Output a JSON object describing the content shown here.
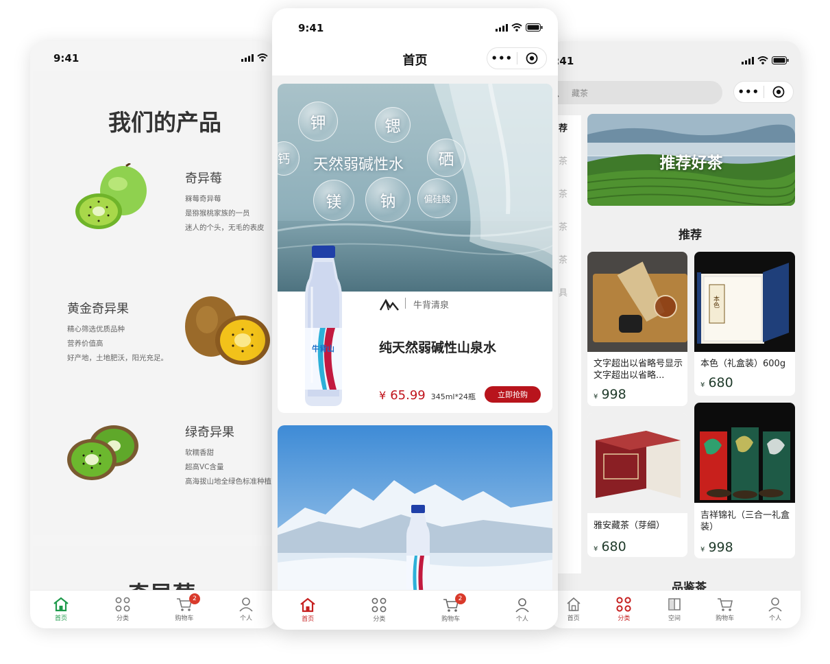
{
  "status": {
    "time": "9:41"
  },
  "left": {
    "section_title": "我们的产品",
    "products": [
      {
        "name": "奇异莓",
        "lines": [
          "槑莓奇异莓",
          "是猕猴桃家族的一员",
          "迷人的个头，无毛的表皮"
        ]
      },
      {
        "name": "黄金奇异果",
        "lines": [
          "精心筛选优质品种",
          "营养价值高",
          "好产地，土地肥沃，阳光充足。"
        ]
      },
      {
        "name": "绿奇异果",
        "lines": [
          "软糯香甜",
          "超高VC含量",
          "高海拔山地全绿色标准种植"
        ]
      }
    ],
    "next_title": "奇异莓",
    "tabs": [
      {
        "label": "首页"
      },
      {
        "label": "分类"
      },
      {
        "label": "购物车",
        "badge": "2"
      },
      {
        "label": "个人"
      }
    ]
  },
  "center": {
    "nav_title": "首页",
    "banner": {
      "headline": "天然弱碱性水",
      "minerals": [
        "钾",
        "锶",
        "钙",
        "硒",
        "镁",
        "钠",
        "偏硅酸"
      ]
    },
    "product": {
      "brand": "牛背清泉",
      "name": "纯天然弱碱性山泉水",
      "currency": "¥",
      "price": "65.99",
      "spec": "345ml*24瓶",
      "buy_label": "立即抢购",
      "bottle_label": "牛背山"
    },
    "tabs": [
      {
        "label": "首页"
      },
      {
        "label": "分类"
      },
      {
        "label": "购物车",
        "badge": "2"
      },
      {
        "label": "个人"
      }
    ]
  },
  "right": {
    "search_placeholder": "藏茶",
    "side_items": [
      "荐",
      "茶",
      "茶",
      "茶",
      "茶",
      "具"
    ],
    "banner_title": "推荐好茶",
    "section_title": "推荐",
    "products": [
      {
        "title": "文字超出以省略号显示 文字超出以省略...",
        "currency": "¥",
        "price": "998"
      },
      {
        "title": "本色（礼盒装）600g",
        "currency": "¥",
        "price": "680",
        "box_label": "本色"
      },
      {
        "title": "雅安藏茶（芽细）",
        "currency": "¥",
        "price": "680"
      },
      {
        "title": "吉祥锦礼（三合一礼盒装）",
        "currency": "¥",
        "price": "998"
      }
    ],
    "next_section": "品鉴茶",
    "tabs": [
      {
        "label": "首页"
      },
      {
        "label": "分类"
      },
      {
        "label": "空间"
      },
      {
        "label": "购物车"
      },
      {
        "label": "个人"
      }
    ]
  },
  "colors": {
    "brand_red": "#c62020",
    "home_green": "#1e9a4b",
    "price_red": "#c0141c",
    "tea_green": "#1f3a2a"
  }
}
